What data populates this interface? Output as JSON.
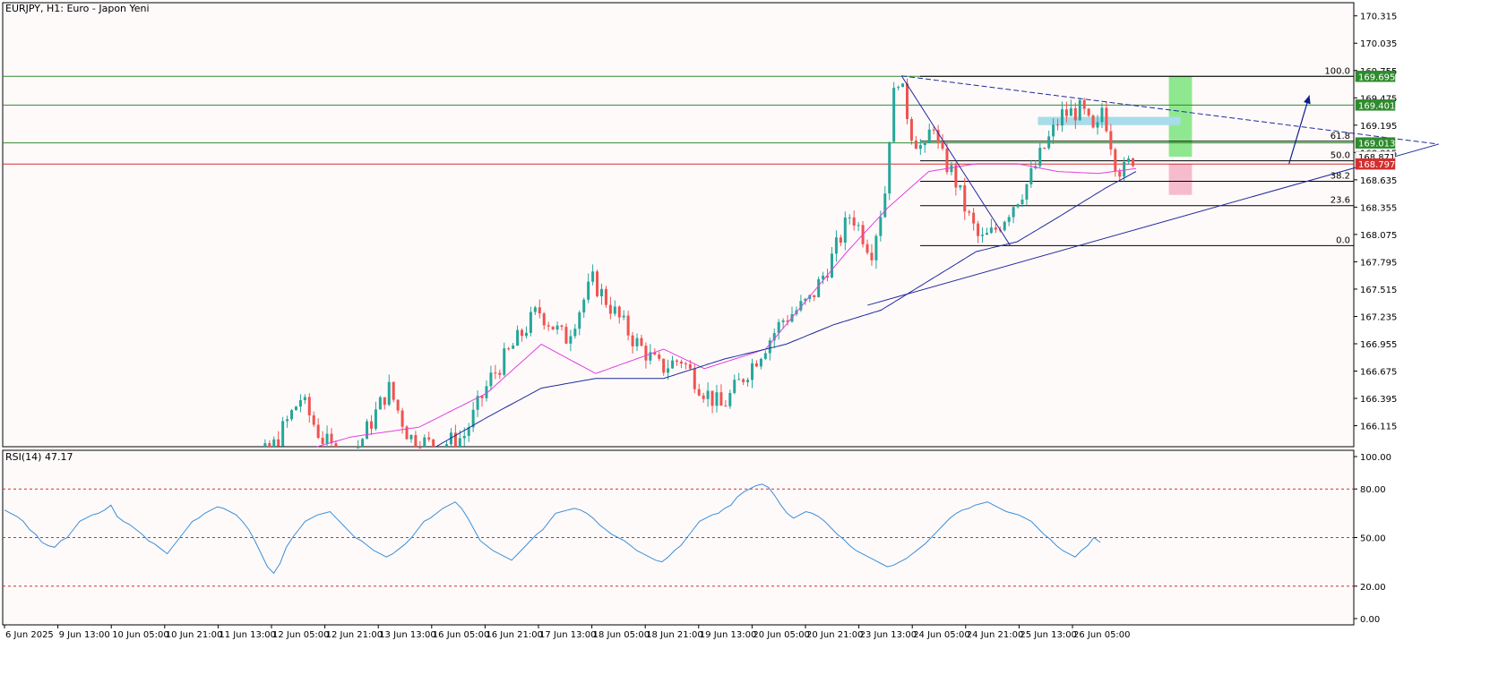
{
  "header": {
    "symbol_label": "EURJPY, H1:  Euro - Japon Yeni"
  },
  "rsi_header": {
    "label": "RSI(14) 47.17"
  },
  "colors": {
    "background": "#ffffff",
    "plot_bg": "#fffafa",
    "bull": "#26a69a",
    "bear": "#ef5350",
    "ma_fast": "#e040e0",
    "ma_slow": "#1f2a9c",
    "level_line": "#2e8b2e",
    "red_level": "#d32f2f",
    "trendline": "#1f2a9c",
    "rsi_line": "#3a8fd8",
    "rsi_level": "#d32f2f",
    "target_zone": "#8fe88f",
    "stop_zone": "#f6bccd",
    "blue_zone": "#a8dcea",
    "arrow": "#0b1f8c"
  },
  "chart_data": [
    {
      "type": "candlestick",
      "symbol": "EURJPY",
      "timeframe": "H1",
      "description": "Euro - Japon Yeni",
      "ylim": [
        165.9,
        170.45
      ],
      "y_ticks": [
        "170.315",
        "170.035",
        "169.755",
        "169.475",
        "169.195",
        "168.915",
        "168.635",
        "168.355",
        "168.075",
        "167.795",
        "167.515",
        "167.235",
        "166.955",
        "166.675",
        "166.395",
        "166.115"
      ],
      "x_ticks": [
        "6 Jun 2025",
        "9 Jun 13:00",
        "10 Jun 05:00",
        "10 Jun 21:00",
        "11 Jun 13:00",
        "12 Jun 05:00",
        "12 Jun 21:00",
        "13 Jun 13:00",
        "16 Jun 05:00",
        "16 Jun 21:00",
        "17 Jun 13:00",
        "18 Jun 05:00",
        "18 Jun 21:00",
        "19 Jun 13:00",
        "20 Jun 05:00",
        "20 Jun 21:00",
        "23 Jun 13:00",
        "24 Jun 05:00",
        "24 Jun 21:00",
        "25 Jun 13:00",
        "26 Jun 05:00"
      ],
      "price_levels": [
        {
          "value": 169.695,
          "label": "169.695",
          "style": "green"
        },
        {
          "value": 169.401,
          "label": "169.401",
          "style": "green"
        },
        {
          "value": 169.013,
          "label": "169.013",
          "style": "green"
        },
        {
          "value": 168.871,
          "label": "168.871",
          "style": "grey"
        },
        {
          "value": 168.797,
          "label": "168.797",
          "style": "red"
        }
      ],
      "fibonacci": [
        {
          "level": "100.0",
          "price": 169.695
        },
        {
          "level": "61.8",
          "price": 169.03
        },
        {
          "level": "50.0",
          "price": 168.83
        },
        {
          "level": "38.2",
          "price": 168.62
        },
        {
          "level": "23.6",
          "price": 168.37
        },
        {
          "level": "0.0",
          "price": 167.96
        }
      ],
      "candles_count": 208,
      "close_path": [
        [
          0,
          165.2
        ],
        [
          8,
          165.6
        ],
        [
          18,
          165.9
        ],
        [
          26,
          166.4
        ],
        [
          32,
          166.0
        ],
        [
          40,
          165.7
        ],
        [
          52,
          166.5
        ],
        [
          58,
          166.0
        ],
        [
          66,
          165.9
        ],
        [
          74,
          166.0
        ],
        [
          82,
          166.6
        ],
        [
          88,
          166.9
        ],
        [
          96,
          167.3
        ],
        [
          104,
          167.0
        ],
        [
          112,
          167.6
        ],
        [
          118,
          167.3
        ],
        [
          124,
          167.0
        ],
        [
          132,
          166.7
        ],
        [
          138,
          166.8
        ],
        [
          144,
          166.5
        ],
        [
          150,
          166.3
        ],
        [
          156,
          166.6
        ],
        [
          162,
          166.9
        ],
        [
          168,
          167.2
        ],
        [
          176,
          167.4
        ],
        [
          182,
          167.8
        ],
        [
          188,
          168.3
        ],
        [
          194,
          167.9
        ],
        [
          198,
          168.5
        ],
        [
          200,
          169.4
        ],
        [
          202,
          169.7
        ],
        [
          206,
          169.1
        ],
        [
          210,
          168.9
        ],
        [
          212,
          169.3
        ],
        [
          214,
          168.9
        ],
        [
          218,
          168.7
        ],
        [
          222,
          168.3
        ],
        [
          226,
          168.0
        ],
        [
          230,
          168.1
        ],
        [
          234,
          168.3
        ],
        [
          240,
          168.6
        ],
        [
          244,
          168.9
        ],
        [
          250,
          169.3
        ],
        [
          256,
          169.35
        ],
        [
          260,
          169.05
        ],
        [
          262,
          169.4
        ],
        [
          266,
          168.8
        ],
        [
          268,
          168.71
        ],
        [
          271,
          168.86
        ]
      ],
      "ma_fast_path": [
        [
          20,
          165.8
        ],
        [
          40,
          166.0
        ],
        [
          60,
          166.1
        ],
        [
          80,
          166.45
        ],
        [
          96,
          166.95
        ],
        [
          104,
          166.8
        ],
        [
          112,
          166.65
        ],
        [
          124,
          166.8
        ],
        [
          132,
          166.9
        ],
        [
          144,
          166.7
        ],
        [
          162,
          166.9
        ],
        [
          174,
          167.4
        ],
        [
          186,
          167.9
        ],
        [
          198,
          168.35
        ],
        [
          210,
          168.72
        ],
        [
          224,
          168.8
        ],
        [
          236,
          168.8
        ],
        [
          248,
          168.72
        ],
        [
          260,
          168.7
        ],
        [
          271,
          168.75
        ]
      ],
      "ma_slow_path": [
        [
          40,
          165.4
        ],
        [
          60,
          165.8
        ],
        [
          80,
          166.2
        ],
        [
          96,
          166.5
        ],
        [
          112,
          166.6
        ],
        [
          132,
          166.6
        ],
        [
          150,
          166.8
        ],
        [
          168,
          166.95
        ],
        [
          182,
          167.15
        ],
        [
          196,
          167.3
        ],
        [
          210,
          167.6
        ],
        [
          224,
          167.9
        ],
        [
          236,
          168.0
        ],
        [
          248,
          168.25
        ],
        [
          262,
          168.55
        ],
        [
          271,
          168.72
        ]
      ],
      "trendlines": [
        {
          "from": [
            202,
            169.7
          ],
          "to": [
            360,
            169.0
          ],
          "style": "dashed"
        },
        {
          "from": [
            192,
            167.35
          ],
          "to": [
            360,
            169.0
          ],
          "style": "solid"
        },
        {
          "from": [
            202,
            169.7
          ],
          "to": [
            234,
            167.96
          ],
          "style": "solid"
        }
      ],
      "zones": [
        {
          "name": "target",
          "x0": 302,
          "x1": 308,
          "y0": 168.871,
          "y1": 169.695
        },
        {
          "name": "stop",
          "x0": 302,
          "x1": 308,
          "y0": 168.48,
          "y1": 168.8
        },
        {
          "name": "blue",
          "x0": 268,
          "x1": 305,
          "y0": 169.195,
          "y1": 169.28
        }
      ],
      "forecast_arrow": {
        "from": [
          316,
          168.8
        ],
        "to": [
          322,
          169.5
        ]
      }
    },
    {
      "type": "line",
      "name": "RSI(14)",
      "value_label": "47.17",
      "ylim": [
        0,
        100
      ],
      "y_ticks": [
        "100.00",
        "80.00",
        "50.00",
        "20.00",
        "0.00"
      ],
      "levels": [
        80,
        50,
        20
      ],
      "values": [
        67,
        65,
        63,
        60,
        55,
        52,
        47,
        45,
        44,
        48,
        50,
        55,
        60,
        62,
        64,
        65,
        67,
        70,
        63,
        60,
        58,
        55,
        52,
        48,
        46,
        43,
        40,
        45,
        50,
        55,
        60,
        62,
        65,
        67,
        69,
        68,
        66,
        64,
        60,
        55,
        48,
        40,
        32,
        28,
        34,
        44,
        50,
        55,
        60,
        62,
        64,
        65,
        66,
        62,
        58,
        54,
        50,
        48,
        45,
        42,
        40,
        38,
        40,
        43,
        46,
        50,
        55,
        60,
        62,
        65,
        68,
        70,
        72,
        68,
        62,
        55,
        48,
        45,
        42,
        40,
        38,
        36,
        40,
        44,
        48,
        52,
        55,
        60,
        65,
        66,
        67,
        68,
        67,
        65,
        62,
        58,
        55,
        52,
        50,
        48,
        45,
        42,
        40,
        38,
        36,
        35,
        38,
        42,
        45,
        50,
        55,
        60,
        62,
        64,
        65,
        68,
        70,
        75,
        78,
        80,
        82,
        83,
        81,
        76,
        70,
        65,
        62,
        64,
        66,
        65,
        63,
        60,
        56,
        52,
        49,
        45,
        42,
        40,
        38,
        36,
        34,
        32,
        33,
        35,
        37,
        40,
        43,
        46,
        50,
        54,
        58,
        62,
        65,
        67,
        68,
        70,
        71,
        72,
        70,
        68,
        66,
        65,
        64,
        62,
        60,
        56,
        52,
        49,
        45,
        42,
        40,
        38,
        42,
        45,
        50,
        47
      ]
    }
  ]
}
